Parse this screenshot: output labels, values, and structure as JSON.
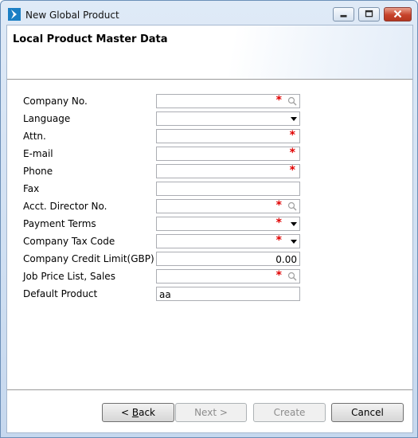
{
  "window": {
    "title": "New Global Product",
    "minimize_icon": "minimize-icon",
    "maximize_icon": "maximize-icon",
    "close_icon": "close-icon"
  },
  "page": {
    "title": "Local Product Master Data"
  },
  "fields": [
    {
      "label": "Company No.",
      "value": "",
      "required": true,
      "control": "lookup"
    },
    {
      "label": "Language",
      "value": "",
      "required": false,
      "control": "dropdown"
    },
    {
      "label": "Attn.",
      "value": "",
      "required": true,
      "control": "text"
    },
    {
      "label": "E-mail",
      "value": "",
      "required": true,
      "control": "text"
    },
    {
      "label": "Phone",
      "value": "",
      "required": true,
      "control": "text"
    },
    {
      "label": "Fax",
      "value": "",
      "required": false,
      "control": "text"
    },
    {
      "label": "Acct. Director No.",
      "value": "",
      "required": true,
      "control": "lookup"
    },
    {
      "label": "Payment Terms",
      "value": "",
      "required": true,
      "control": "dropdown"
    },
    {
      "label": "Company Tax Code",
      "value": "",
      "required": true,
      "control": "dropdown"
    },
    {
      "label": "Company Credit Limit(GBP)",
      "value": "0.00",
      "required": false,
      "control": "number"
    },
    {
      "label": "Job Price List, Sales",
      "value": "",
      "required": true,
      "control": "lookup"
    },
    {
      "label": "Default Product",
      "value": "aa",
      "required": false,
      "control": "text"
    }
  ],
  "required_marker": "*",
  "buttons": {
    "back_prefix": "",
    "back_mnemonic": "B",
    "back_rest": "ack",
    "back_arrow": "< ",
    "next": "Next >",
    "create": "Create",
    "cancel": "Cancel"
  },
  "colors": {
    "required": "#e00000",
    "accent": "#1b7fc4"
  }
}
